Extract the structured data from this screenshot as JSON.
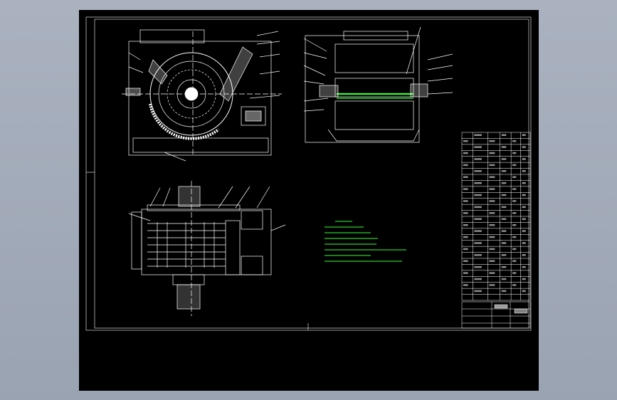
{
  "viewport": {
    "background_color": "#a3abb9",
    "sheet_color": "#000000",
    "line_color": "#ffffff",
    "note_color": "#33ff33"
  },
  "drawing": {
    "views": [
      "top-view",
      "side-view",
      "front-section-view"
    ],
    "technical_requirements": {
      "title": "",
      "items": []
    },
    "parts_list": {
      "row_count": 28,
      "column_count": 6
    },
    "title_block": {
      "drawing_name": "",
      "company": ""
    }
  }
}
